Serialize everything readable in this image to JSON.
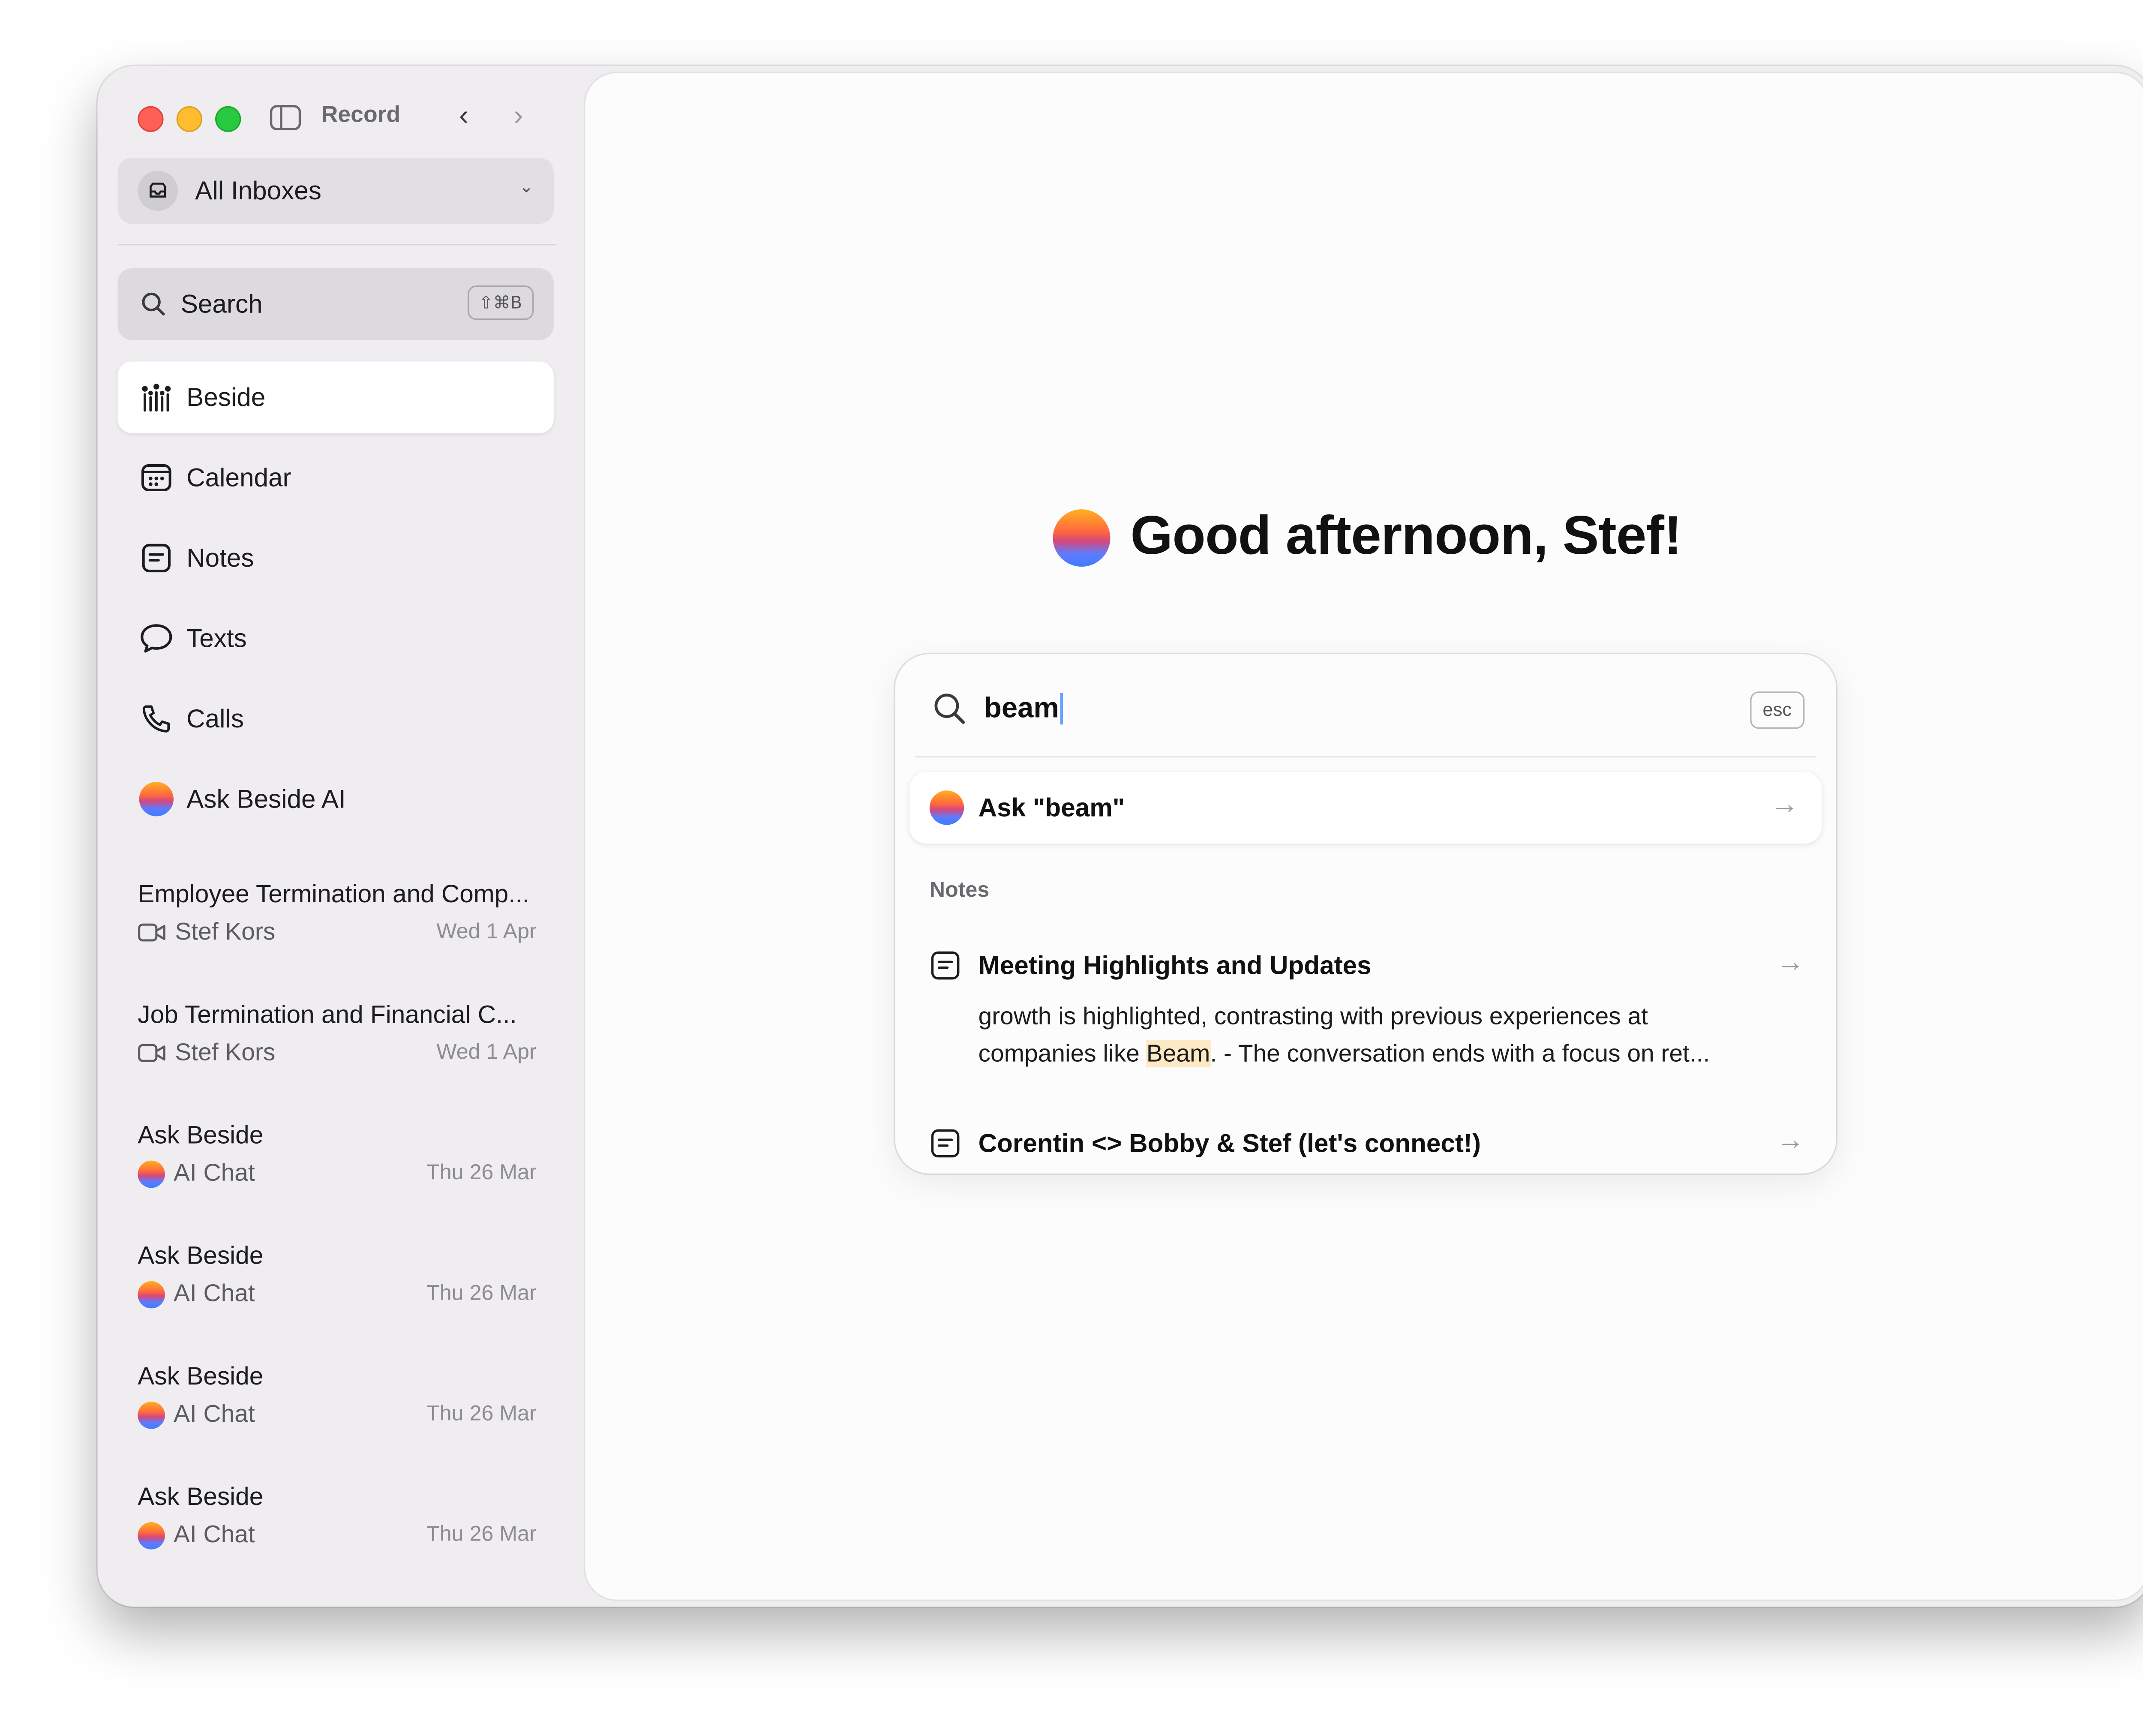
{
  "toolbar": {
    "record_label": "Record"
  },
  "sidebar": {
    "inbox_selector": "All Inboxes",
    "search": {
      "label": "Search",
      "shortcut": "⇧⌘B"
    },
    "items": [
      {
        "label": "Beside",
        "icon": "people-grid-icon",
        "active": true
      },
      {
        "label": "Calendar",
        "icon": "calendar-icon"
      },
      {
        "label": "Notes",
        "icon": "note-icon"
      },
      {
        "label": "Texts",
        "icon": "chat-bubble-icon"
      },
      {
        "label": "Calls",
        "icon": "phone-icon"
      },
      {
        "label": "Ask Beside AI",
        "icon": "ai-orb-icon"
      }
    ],
    "recents": [
      {
        "title": "Employee Termination and Comp...",
        "sub": "Stef Kors",
        "date": "Wed 1 Apr",
        "icon": "video-icon"
      },
      {
        "title": "Job Termination and Financial C...",
        "sub": "Stef Kors",
        "date": "Wed 1 Apr",
        "icon": "video-icon"
      },
      {
        "title": "Ask Beside",
        "sub": "AI Chat",
        "date": "Thu 26 Mar",
        "icon": "ai-orb-icon"
      },
      {
        "title": "Ask Beside",
        "sub": "AI Chat",
        "date": "Thu 26 Mar",
        "icon": "ai-orb-icon"
      },
      {
        "title": "Ask Beside",
        "sub": "AI Chat",
        "date": "Thu 26 Mar",
        "icon": "ai-orb-icon"
      },
      {
        "title": "Ask Beside",
        "sub": "AI Chat",
        "date": "Thu 26 Mar",
        "icon": "ai-orb-icon"
      }
    ]
  },
  "main": {
    "greeting": "Good afternoon, Stef!",
    "palette": {
      "query": "beam",
      "esc_label": "esc",
      "ask_label": "Ask \"beam\"",
      "section_label": "Notes",
      "results": [
        {
          "title": "Meeting Highlights and Updates",
          "snippet_line1": "growth is highlighted, contrasting with previous experiences at",
          "snippet_pre": "companies like ",
          "snippet_match": "Beam",
          "snippet_post": ". - The conversation ends with a focus on ret..."
        },
        {
          "title": "Corentin <> Bobby & Stef (let's connect!)"
        }
      ]
    }
  },
  "colors": {
    "sidebar_bg": "#efedf0",
    "main_bg": "#fdfcfd",
    "highlight": "#fde9c4",
    "traffic_red": "#fe5f57",
    "traffic_yellow": "#febc2e",
    "traffic_green": "#28c840"
  }
}
